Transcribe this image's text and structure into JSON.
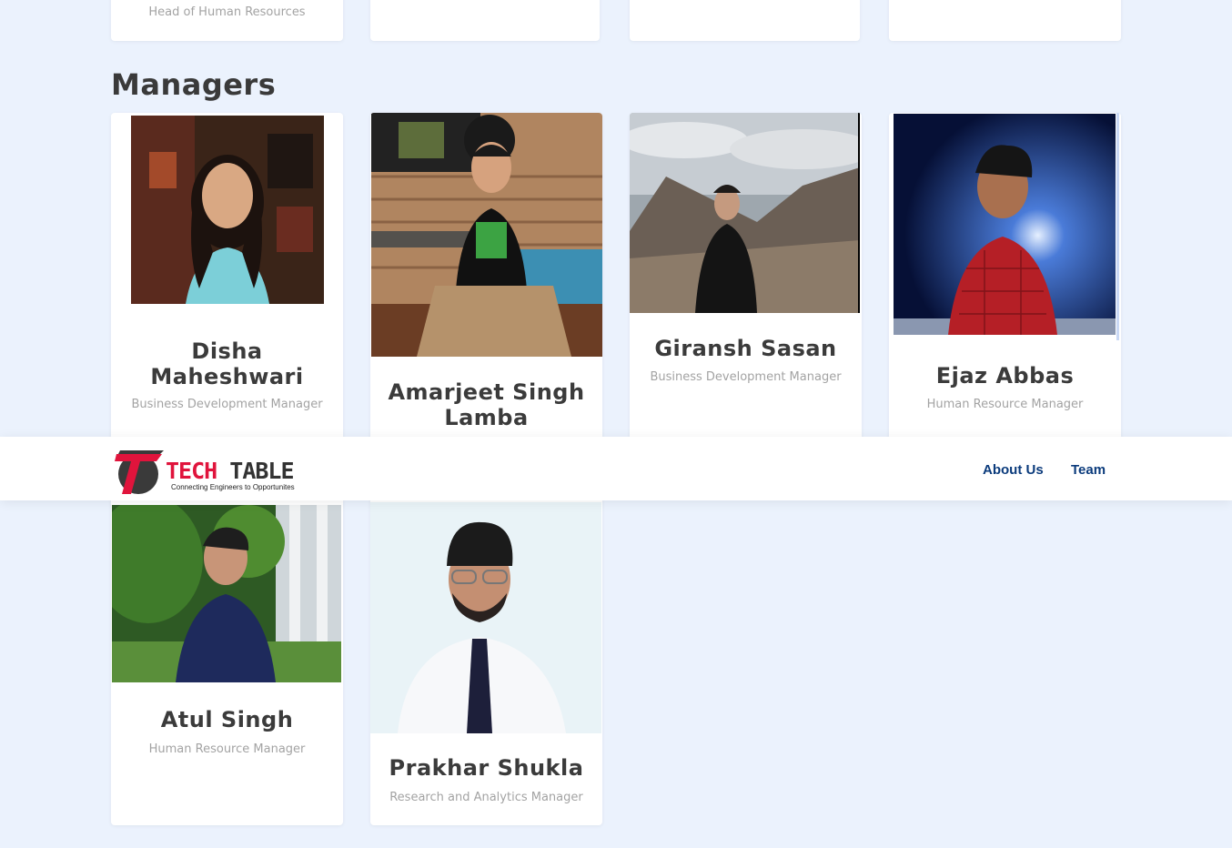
{
  "top_row": {
    "card1_role": "Head of Human Resources"
  },
  "section": {
    "title": "Managers"
  },
  "managers": [
    {
      "name": "Disha Maheshwari",
      "role": "Business Development Manager"
    },
    {
      "name": "Amarjeet Singh Lamba",
      "role": ""
    },
    {
      "name": "Giransh Sasan",
      "role": "Business Development Manager"
    },
    {
      "name": "Ejaz Abbas",
      "role": "Human Resource Manager"
    },
    {
      "name": "Atul Singh",
      "role": "Human Resource Manager"
    },
    {
      "name": "Prakhar Shukla",
      "role": "Research and Analytics Manager"
    }
  ],
  "navbar": {
    "logo_tech": "TECH",
    "logo_table": " TABLE",
    "logo_tagline": "Connecting Engineers to Opportunites",
    "links": [
      "About Us",
      "Team"
    ]
  },
  "colors": {
    "background": "#ebf2fd",
    "nav_link": "#0b3b7c",
    "logo_red": "#e0143c",
    "name_text": "#3b3b3b",
    "role_text": "#a3a3a3"
  }
}
